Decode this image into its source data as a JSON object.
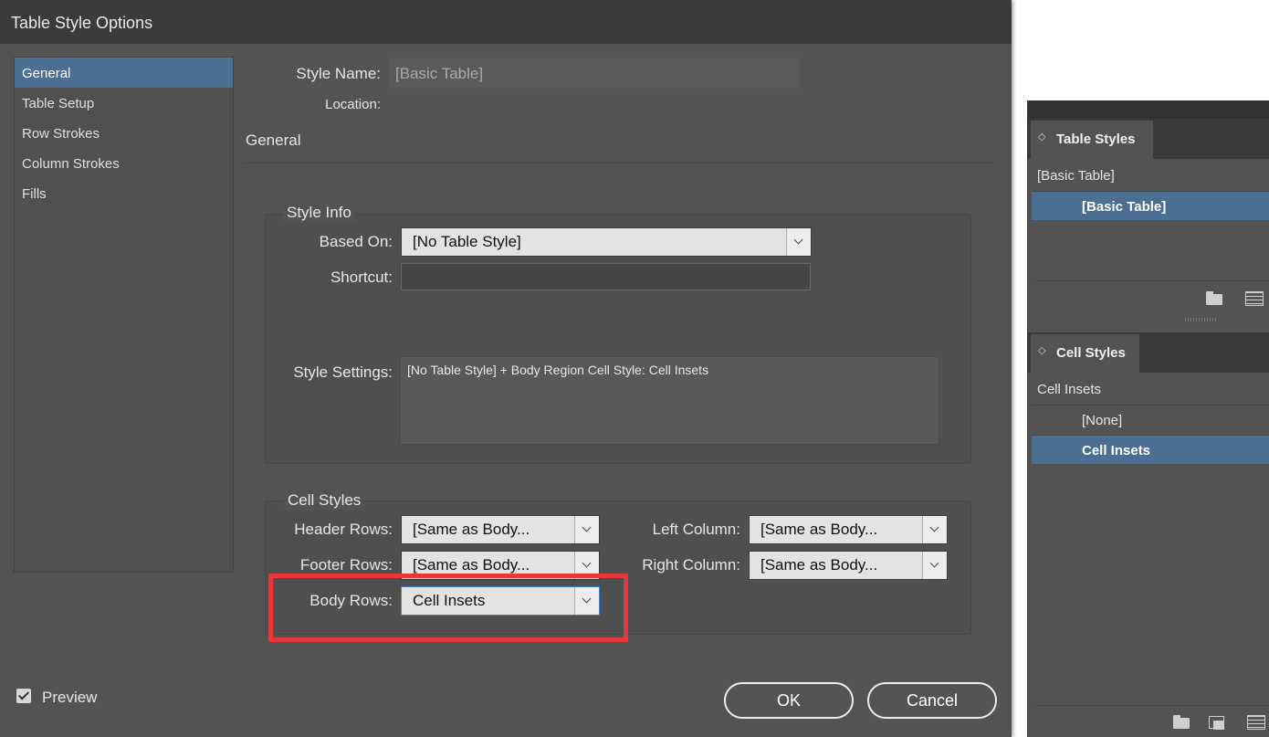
{
  "dialog": {
    "title": "Table Style Options",
    "categories": [
      "General",
      "Table Setup",
      "Row Strokes",
      "Column Strokes",
      "Fills"
    ],
    "selected_category": "General",
    "style_name_label": "Style Name:",
    "style_name_value": "[Basic Table]",
    "location_label": "Location:",
    "section_title": "General",
    "style_info": {
      "title": "Style Info",
      "based_on_label": "Based On:",
      "based_on_value": "[No Table Style]",
      "shortcut_label": "Shortcut:",
      "shortcut_value": "",
      "style_settings_label": "Style Settings:",
      "style_settings_value": "[No Table Style] + Body Region Cell Style: Cell Insets"
    },
    "cell_styles": {
      "title": "Cell Styles",
      "header_rows_label": "Header Rows:",
      "header_rows_value": "[Same as Body...",
      "footer_rows_label": "Footer Rows:",
      "footer_rows_value": "[Same as Body...",
      "body_rows_label": "Body Rows:",
      "body_rows_value": "Cell Insets",
      "left_column_label": "Left Column:",
      "left_column_value": "[Same as Body...",
      "right_column_label": "Right Column:",
      "right_column_value": "[Same as Body..."
    },
    "preview_label": "Preview",
    "preview_checked": true,
    "ok_label": "OK",
    "cancel_label": "Cancel",
    "highlight_color": "#e8363d"
  },
  "panel": {
    "table_styles_tab": "Table Styles",
    "table_styles_current": "[Basic Table]",
    "table_styles_items": [
      "[Basic Table]"
    ],
    "cell_styles_tab": "Cell Styles",
    "cell_styles_current": "Cell Insets",
    "cell_styles_items": [
      "[None]",
      "Cell Insets"
    ],
    "selected_color": "#4a6f93"
  }
}
